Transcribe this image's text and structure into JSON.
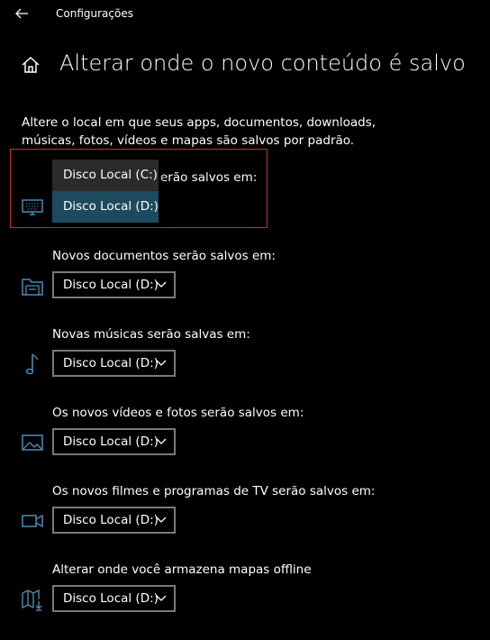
{
  "window": {
    "title": "Configurações"
  },
  "page": {
    "title": "Alterar onde o novo conteúdo é salvo",
    "description": "Altere o local em que seus apps, documentos, downloads, músicas, fotos, vídeos e mapas são salvos por padrão."
  },
  "sections": [
    {
      "label": "Novos apps serão salvos em:",
      "visible_label": "erão salvos em:",
      "value": "Disco Local (D:)",
      "icon": "monitor-icon"
    },
    {
      "label": "Novos documentos serão salvos em:",
      "value": "Disco Local (D:)",
      "icon": "folder-icon"
    },
    {
      "label": "Novas músicas serão salvas em:",
      "value": "Disco Local (D:)",
      "icon": "music-note-icon"
    },
    {
      "label": "Os novos vídeos e fotos serão salvos em:",
      "value": "Disco Local (D:)",
      "icon": "picture-icon"
    },
    {
      "label": "Os novos filmes e programas de TV serão salvos em:",
      "value": "Disco Local (D:)",
      "icon": "video-camera-icon"
    },
    {
      "label": "Alterar onde você armazena mapas offline",
      "value": "Disco Local (D:)",
      "icon": "map-download-icon"
    }
  ],
  "popup": {
    "options": [
      "Disco Local (C:)",
      "Disco Local (D:)"
    ],
    "selected": "Disco Local (D:)"
  },
  "colors": {
    "accent": "#4a8bb5",
    "highlight_border": "#d12b2b",
    "selected_bg": "#1e4a5f"
  }
}
